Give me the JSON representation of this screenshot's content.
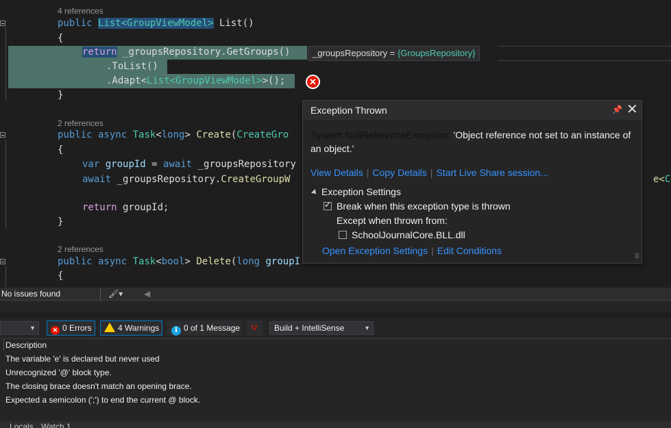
{
  "editor": {
    "ref1": "4 references",
    "ref2": "2 references",
    "ref3": "2 references",
    "l1": {
      "kw": "public",
      "type": "List<GroupViewModel>",
      "name": " List()"
    },
    "l2": "{",
    "l3": {
      "kw": "return",
      "rest": " _groupsRepository.GetGroups()"
    },
    "l4": ".ToList()",
    "l5": {
      "pre": ".Adapt<",
      "type": "List<GroupViewModel>",
      "post": ">();"
    },
    "l6": "}",
    "l7": {
      "kw": "public async",
      "type1": "Task",
      "lt": "<",
      "kw2": "long",
      "gt": ">",
      "fn": " Create",
      "paren": "(",
      "type2": "CreateGro"
    },
    "l8": "{",
    "l9": {
      "kw": "var",
      "var": " groupId",
      "eq": " = ",
      "kw2": "await",
      "rest": " _groupsRepository"
    },
    "l10": {
      "kw": "await",
      "rest": " _groupsRepository.",
      "fn": "CreateGroupW"
    },
    "l10tail": {
      "fn": "e<",
      "type": "Cre"
    },
    "l11": {
      "kw": "return",
      "rest": " groupId;"
    },
    "l12": "}",
    "l13": {
      "kw": "public async",
      "type1": "Task",
      "lt": "<",
      "kw2": "bool",
      "gt": ">",
      "fn": " Delete",
      "paren": "(",
      "kw3": "long",
      "var": " groupI"
    }
  },
  "datatip": {
    "name": "_groupsRepository",
    "eq": " = ",
    "value": "{GroupsRepository}"
  },
  "exception": {
    "title": "Exception Thrown",
    "type": "System.NullReferenceException:",
    "message": " 'Object reference not set to an instance of an object.'",
    "links": [
      "View Details",
      "Copy Details",
      "Start Live Share session..."
    ],
    "settings_title": "Exception Settings",
    "break_label": "Break when this exception type is thrown",
    "except_label": "Except when thrown from:",
    "module_label": "SchoolJournalCore.BLL.dll",
    "bottom_links": [
      "Open Exception Settings",
      "Edit Conditions"
    ]
  },
  "status": {
    "issues": "No issues found"
  },
  "error_list": {
    "errors": "0 Errors",
    "warnings": "4 Warnings",
    "messages": "0 of 1 Message",
    "build_filter": "Build + IntelliSense",
    "column": "Description",
    "rows": [
      "The variable 'e' is declared but never used",
      "Unrecognized '@' block type.",
      "The closing brace doesn't match an opening brace.",
      "Expected a semicolon (';') to end the current @ block."
    ]
  },
  "tabs": [
    "Locals",
    "Watch 1"
  ]
}
